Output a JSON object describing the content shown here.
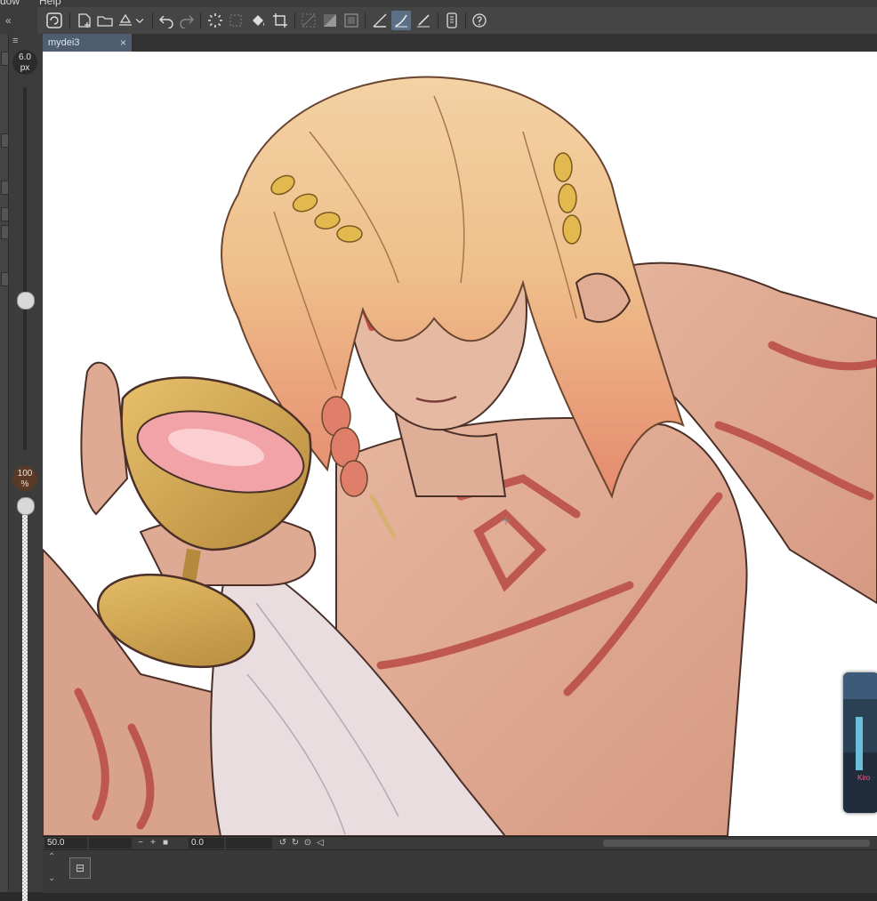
{
  "menu": {
    "items": [
      "dow",
      "Help"
    ]
  },
  "toolbar": {
    "buttons": [
      "app-logo",
      "new-canvas",
      "open-file",
      "save",
      "dropdown",
      "undo",
      "redo",
      "loading",
      "transform",
      "fill",
      "crop",
      "select-none",
      "select-invert",
      "select-border",
      "ruler-snap",
      "brush-stroke",
      "pen-stroke",
      "device",
      "help"
    ]
  },
  "brush": {
    "size_value": "6.0",
    "size_unit": "px",
    "opacity_value": "100",
    "opacity_unit": "%"
  },
  "document": {
    "tab_title": "mydei3",
    "close_glyph": "×"
  },
  "status": {
    "zoom": "50.0",
    "rotation": "0.0"
  },
  "bottom_panel": {
    "icon_glyph": "⊟"
  },
  "thumbnail": {
    "label": "Kiro"
  }
}
